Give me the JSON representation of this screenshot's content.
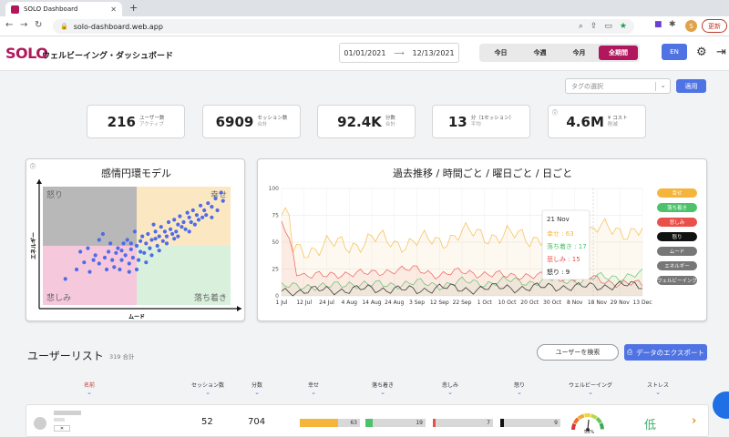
{
  "browser": {
    "tab_title": "SOLO Dashboard",
    "url": "solo-dashboard.web.app",
    "update_label": "更新",
    "profile_initial": "S"
  },
  "header": {
    "logo": "SOLO",
    "subtitle": "ウェルビーイング・ダッシュボード",
    "date_from": "01/01/2021",
    "date_to": "12/13/2021",
    "periods": [
      "今日",
      "今週",
      "今月",
      "全期間"
    ],
    "active_period": 3,
    "lang": "EN"
  },
  "filters": {
    "tag_placeholder": "タグの選択",
    "apply_label": "適用"
  },
  "stats": [
    {
      "value": "216",
      "label": "ユーザー数",
      "sub": "アクティブ"
    },
    {
      "value": "6909",
      "label": "セッション数",
      "sub": "合計"
    },
    {
      "value": "92.4K",
      "label": "分数",
      "sub": "合計"
    },
    {
      "value": "13",
      "label": "分（1セッション）",
      "sub": "平均"
    },
    {
      "value": "4.6M",
      "label": "¥ コスト",
      "sub": "削減"
    }
  ],
  "emotion_panel": {
    "title": "感情円環モデル",
    "quadrants": {
      "anger": "怒り",
      "happy": "幸せ",
      "sad": "悲しみ",
      "calm": "落ち着き"
    },
    "x_label": "ムード",
    "y_label": "エネルギー",
    "colors": {
      "anger": "#b8b8b8",
      "happy": "#fbe8c3",
      "sad": "#f6c8dc",
      "calm": "#d8f0dc",
      "point": "#4f6be8"
    },
    "points": [
      [
        0.12,
        0.22
      ],
      [
        0.18,
        0.3
      ],
      [
        0.22,
        0.36
      ],
      [
        0.25,
        0.28
      ],
      [
        0.28,
        0.42
      ],
      [
        0.3,
        0.35
      ],
      [
        0.33,
        0.4
      ],
      [
        0.35,
        0.45
      ],
      [
        0.38,
        0.32
      ],
      [
        0.4,
        0.48
      ],
      [
        0.42,
        0.38
      ],
      [
        0.44,
        0.42
      ],
      [
        0.45,
        0.55
      ],
      [
        0.47,
        0.47
      ],
      [
        0.48,
        0.4
      ],
      [
        0.5,
        0.5
      ],
      [
        0.52,
        0.45
      ],
      [
        0.53,
        0.58
      ],
      [
        0.55,
        0.52
      ],
      [
        0.56,
        0.6
      ],
      [
        0.58,
        0.55
      ],
      [
        0.6,
        0.62
      ],
      [
        0.62,
        0.58
      ],
      [
        0.63,
        0.66
      ],
      [
        0.65,
        0.62
      ],
      [
        0.67,
        0.7
      ],
      [
        0.68,
        0.64
      ],
      [
        0.7,
        0.72
      ],
      [
        0.72,
        0.68
      ],
      [
        0.73,
        0.75
      ],
      [
        0.75,
        0.7
      ],
      [
        0.77,
        0.78
      ],
      [
        0.78,
        0.74
      ],
      [
        0.8,
        0.8
      ],
      [
        0.82,
        0.76
      ],
      [
        0.84,
        0.84
      ],
      [
        0.86,
        0.8
      ],
      [
        0.88,
        0.86
      ],
      [
        0.9,
        0.83
      ],
      [
        0.92,
        0.9
      ],
      [
        0.95,
        0.95
      ],
      [
        0.3,
        0.55
      ],
      [
        0.36,
        0.52
      ],
      [
        0.41,
        0.3
      ],
      [
        0.46,
        0.35
      ],
      [
        0.49,
        0.62
      ],
      [
        0.51,
        0.38
      ],
      [
        0.54,
        0.44
      ],
      [
        0.57,
        0.48
      ],
      [
        0.59,
        0.68
      ],
      [
        0.61,
        0.5
      ],
      [
        0.64,
        0.54
      ],
      [
        0.66,
        0.58
      ],
      [
        0.69,
        0.6
      ],
      [
        0.71,
        0.62
      ],
      [
        0.74,
        0.66
      ],
      [
        0.76,
        0.64
      ],
      [
        0.79,
        0.7
      ],
      [
        0.81,
        0.68
      ],
      [
        0.83,
        0.72
      ],
      [
        0.85,
        0.74
      ],
      [
        0.87,
        0.76
      ],
      [
        0.24,
        0.48
      ],
      [
        0.2,
        0.45
      ],
      [
        0.32,
        0.6
      ],
      [
        0.43,
        0.52
      ],
      [
        0.37,
        0.38
      ],
      [
        0.39,
        0.44
      ],
      [
        0.34,
        0.3
      ],
      [
        0.27,
        0.38
      ],
      [
        0.58,
        0.42
      ],
      [
        0.62,
        0.46
      ],
      [
        0.66,
        0.52
      ],
      [
        0.7,
        0.56
      ],
      [
        0.72,
        0.58
      ],
      [
        0.78,
        0.62
      ],
      [
        0.9,
        0.74
      ],
      [
        0.93,
        0.8
      ],
      [
        0.96,
        0.88
      ],
      [
        0.55,
        0.36
      ],
      [
        0.5,
        0.3
      ],
      [
        0.46,
        0.28
      ],
      [
        0.42,
        0.46
      ],
      [
        0.47,
        0.52
      ],
      [
        0.52,
        0.54
      ],
      [
        0.6,
        0.56
      ]
    ]
  },
  "trend_panel": {
    "title": "過去推移 / 時間ごと / 曜日ごと / 日ごと"
  },
  "chart_data": {
    "type": "line",
    "x": [
      "1 Jul",
      "12 Jul",
      "24 Jul",
      "4 Aug",
      "14 Aug",
      "24 Aug",
      "3 Sep",
      "12 Sep",
      "22 Sep",
      "1 Oct",
      "10 Oct",
      "20 Oct",
      "30 Oct",
      "8 Nov",
      "18 Nov",
      "29 Nov",
      "13 Dec"
    ],
    "ylim": [
      0,
      100
    ],
    "yticks": [
      0,
      25,
      50,
      75,
      100
    ],
    "series": [
      {
        "name": "幸せ",
        "color": "#f5b53c",
        "values": [
          45,
          40,
          50,
          45,
          55,
          48,
          52,
          50,
          60,
          55,
          58,
          52,
          60,
          55,
          63,
          60,
          62
        ]
      },
      {
        "name": "落ち着き",
        "color": "#4ec26a",
        "values": [
          8,
          10,
          8,
          12,
          10,
          11,
          12,
          10,
          13,
          12,
          14,
          13,
          15,
          14,
          17,
          18,
          20
        ]
      },
      {
        "name": "悲しみ",
        "color": "#e8504a",
        "values": [
          30,
          20,
          18,
          22,
          20,
          25,
          24,
          20,
          22,
          21,
          18,
          20,
          16,
          18,
          15,
          12,
          10
        ]
      },
      {
        "name": "怒り",
        "color": "#111111",
        "values": [
          5,
          4,
          6,
          5,
          7,
          6,
          5,
          8,
          6,
          7,
          8,
          7,
          9,
          8,
          9,
          10,
          9
        ]
      }
    ],
    "tooltip": {
      "date": "21 Nov",
      "rows": [
        {
          "name": "幸せ",
          "value": "63"
        },
        {
          "name": "落ち着き",
          "value": "17"
        },
        {
          "name": "悲しみ",
          "value": "15"
        },
        {
          "name": "怒り",
          "value": "9"
        }
      ]
    },
    "legend_extra": [
      "ムード",
      "エネルギー",
      "ウェルビーイング"
    ]
  },
  "users": {
    "title": "ユーザーリスト",
    "count": "319 合計",
    "search_label": "ユーザーを検索",
    "export_label": "データのエクスポート",
    "columns": [
      "名前",
      "セッション数",
      "分数",
      "幸せ",
      "落ち着き",
      "悲しみ",
      "怒り",
      "ウェルビーイング",
      "ストレス"
    ],
    "rows": [
      {
        "sessions": "52",
        "minutes": "704",
        "happy": 63,
        "calm": 19,
        "sad": 7,
        "anger": 9,
        "wellbeing": "53%",
        "stress": "低"
      }
    ]
  }
}
